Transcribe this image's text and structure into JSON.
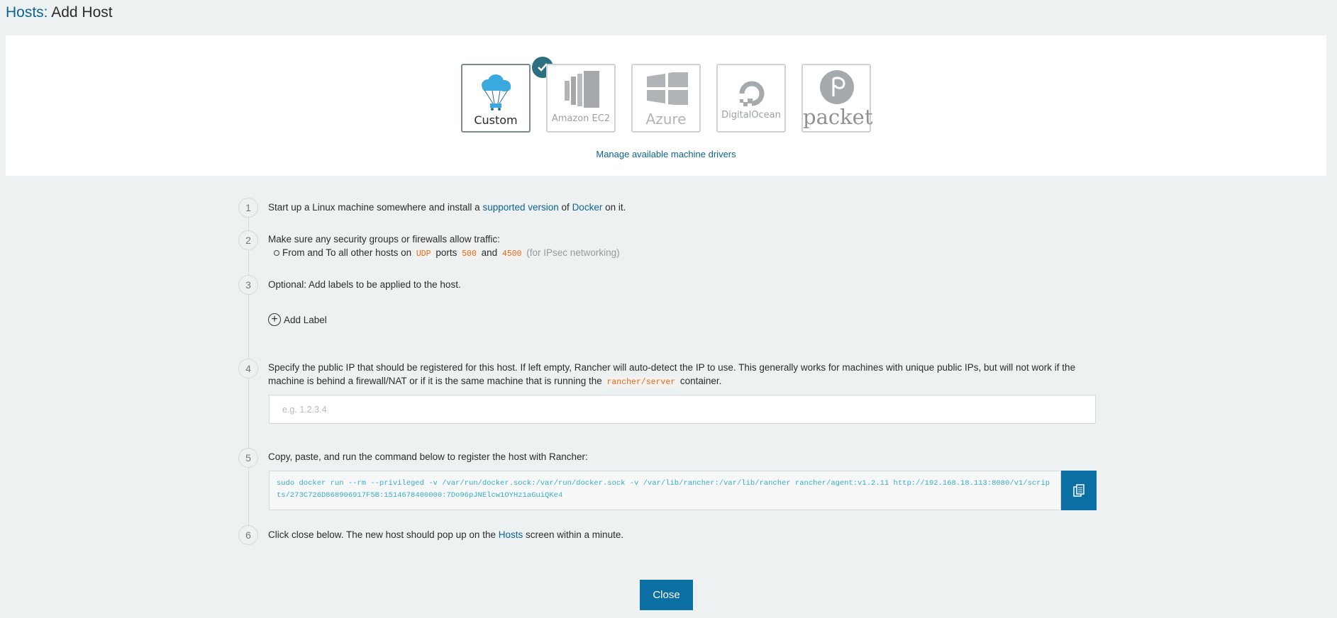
{
  "header": {
    "breadcrumb": "Hosts:",
    "title": "Add Host"
  },
  "drivers": [
    {
      "name": "Custom",
      "selected": true,
      "icon": "parachute-cloud-icon"
    },
    {
      "name": "Amazon EC2",
      "icon": "amazon-ec2-icon"
    },
    {
      "name": "Azure",
      "icon": "azure-windows-icon"
    },
    {
      "name": "DigitalOcean",
      "icon": "digitalocean-icon"
    },
    {
      "name": "packet",
      "icon": "packet-icon"
    }
  ],
  "manage_link": "Manage available machine drivers",
  "steps": {
    "s1": {
      "num": "1",
      "pre": "Start up a Linux machine somewhere and install a",
      "link1": "supported version",
      "mid": "of",
      "link2": "Docker",
      "post": "on it."
    },
    "s2": {
      "num": "2",
      "text": "Make sure any security groups or firewalls allow traffic:",
      "bullet_pre": "From and To all other hosts on",
      "proto": "UDP",
      "ports_word": "ports",
      "port1": "500",
      "and_word": "and",
      "port2": "4500",
      "note": "(for IPsec networking)"
    },
    "s3": {
      "num": "3",
      "text": "Optional: Add labels to be applied to the host.",
      "add_label": "Add Label"
    },
    "s4": {
      "num": "4",
      "text": "Specify the public IP that should be registered for this host. If left empty, Rancher will auto-detect the IP to use. This generally works for machines with unique public IPs, but will not work if the machine is behind a firewall/NAT or if it is the same machine that is running the",
      "code": "rancher/server",
      "post": "container.",
      "placeholder": "e.g. 1.2.3.4",
      "value": ""
    },
    "s5": {
      "num": "5",
      "text": "Copy, paste, and run the command below to register the host with Rancher:",
      "command": "sudo docker run --rm --privileged -v /var/run/docker.sock:/var/run/docker.sock -v /var/lib/rancher:/var/lib/rancher rancher/agent:v1.2.11 http://192.168.18.113:8080/v1/scripts/273C726D868906917F5B:1514678400000:7Do96pJNElcw1OYHz1aGuiQKe4"
    },
    "s6": {
      "num": "6",
      "pre": "Click close below. The new host should pop up on the",
      "link": "Hosts",
      "post": "screen within a minute."
    }
  },
  "close_label": "Close",
  "colors": {
    "accent": "#0b6fa3",
    "link": "#0e6395",
    "badge": "#2d6e80",
    "code": "#e66a1a",
    "command": "#3aa9c8"
  }
}
